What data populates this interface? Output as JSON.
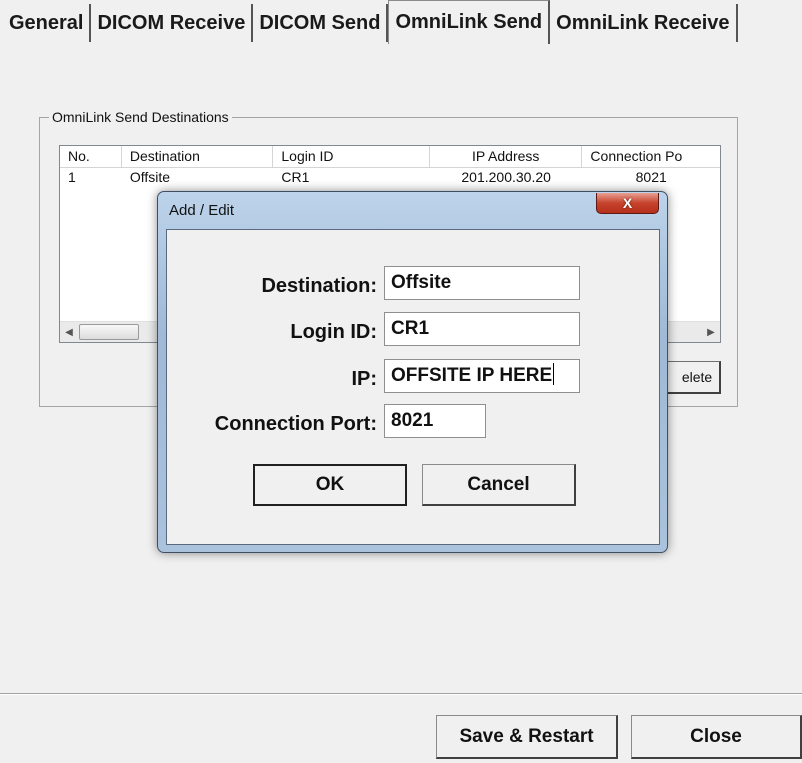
{
  "tabs": [
    {
      "label": "General",
      "active": false
    },
    {
      "label": "DICOM Receive",
      "active": false
    },
    {
      "label": "DICOM Send",
      "active": false
    },
    {
      "label": "OmniLink Send",
      "active": true
    },
    {
      "label": "OmniLink Receive",
      "active": false
    }
  ],
  "group": {
    "title": "OmniLink Send Destinations",
    "columns": [
      "No.",
      "Destination",
      "Login ID",
      "IP Address",
      "Connection Po"
    ],
    "rows": [
      {
        "no": "1",
        "destination": "Offsite",
        "login_id": "CR1",
        "ip": "201.200.30.20",
        "port": "8021"
      }
    ],
    "delete_label": "elete"
  },
  "dialog": {
    "title": "Add / Edit",
    "close_glyph": "X",
    "fields": {
      "destination": {
        "label": "Destination:",
        "value": "Offsite"
      },
      "login": {
        "label": "Login ID:",
        "value": "CR1"
      },
      "ip": {
        "label": "IP:",
        "value": "OFFSITE IP HERE"
      },
      "port": {
        "label": "Connection Port:",
        "value": "8021"
      }
    },
    "ok_label": "OK",
    "cancel_label": "Cancel"
  },
  "footer": {
    "save_label": "Save & Restart",
    "close_label": "Close"
  },
  "icons": {
    "scroll_left": "chevron-left-icon",
    "scroll_right": "chevron-right-icon",
    "close": "close-icon"
  }
}
